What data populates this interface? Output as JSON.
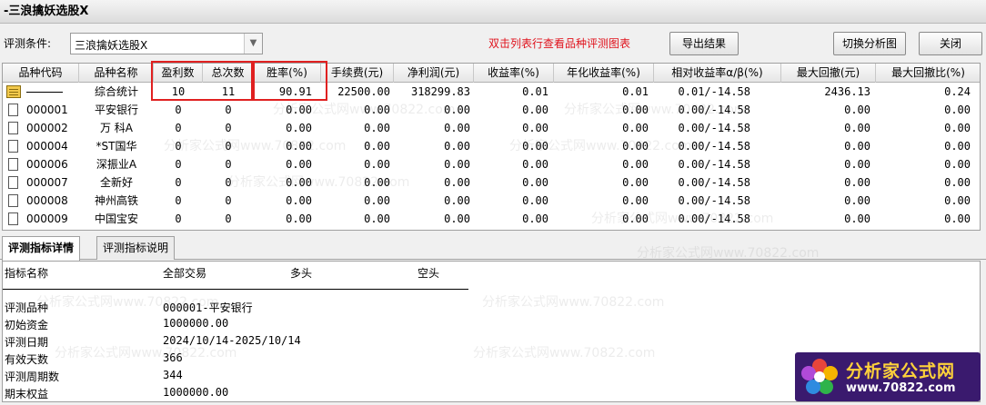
{
  "window": {
    "title": "-三浪擒妖选股X"
  },
  "toolbar": {
    "condition_label": "评测条件:",
    "condition_value": "三浪擒妖选股X",
    "hint": "双击列表行查看品种评测图表",
    "export_label": "导出结果",
    "switch_label": "切换分析图",
    "close_label": "关闭"
  },
  "table": {
    "headers": [
      "品种代码",
      "品种名称",
      "盈利数",
      "总次数",
      "胜率(%)",
      "手续费(元)",
      "净利润(元)",
      "收益率(%)",
      "年化收益率(%)",
      "相对收益率α/β(%)",
      "最大回撤(元)",
      "最大回撤比(%)"
    ],
    "rows": [
      {
        "code": "",
        "name": "综合统计",
        "wins": "10",
        "total": "11",
        "winrate": "90.91",
        "fee": "22500.00",
        "profit": "318299.83",
        "ret": "0.01",
        "annual": "0.01",
        "relative": "0.01/-14.58",
        "maxdd": "2436.13",
        "maxddr": "0.24"
      },
      {
        "code": "000001",
        "name": "平安银行",
        "wins": "0",
        "total": "0",
        "winrate": "0.00",
        "fee": "0.00",
        "profit": "0.00",
        "ret": "0.00",
        "annual": "0.00",
        "relative": "0.00/-14.58",
        "maxdd": "0.00",
        "maxddr": "0.00"
      },
      {
        "code": "000002",
        "name": "万 科A",
        "wins": "0",
        "total": "0",
        "winrate": "0.00",
        "fee": "0.00",
        "profit": "0.00",
        "ret": "0.00",
        "annual": "0.00",
        "relative": "0.00/-14.58",
        "maxdd": "0.00",
        "maxddr": "0.00"
      },
      {
        "code": "000004",
        "name": "*ST国华",
        "wins": "0",
        "total": "0",
        "winrate": "0.00",
        "fee": "0.00",
        "profit": "0.00",
        "ret": "0.00",
        "annual": "0.00",
        "relative": "0.00/-14.58",
        "maxdd": "0.00",
        "maxddr": "0.00"
      },
      {
        "code": "000006",
        "name": "深振业A",
        "wins": "0",
        "total": "0",
        "winrate": "0.00",
        "fee": "0.00",
        "profit": "0.00",
        "ret": "0.00",
        "annual": "0.00",
        "relative": "0.00/-14.58",
        "maxdd": "0.00",
        "maxddr": "0.00"
      },
      {
        "code": "000007",
        "name": "全新好",
        "wins": "0",
        "total": "0",
        "winrate": "0.00",
        "fee": "0.00",
        "profit": "0.00",
        "ret": "0.00",
        "annual": "0.00",
        "relative": "0.00/-14.58",
        "maxdd": "0.00",
        "maxddr": "0.00"
      },
      {
        "code": "000008",
        "name": "神州高铁",
        "wins": "0",
        "total": "0",
        "winrate": "0.00",
        "fee": "0.00",
        "profit": "0.00",
        "ret": "0.00",
        "annual": "0.00",
        "relative": "0.00/-14.58",
        "maxdd": "0.00",
        "maxddr": "0.00"
      },
      {
        "code": "000009",
        "name": "中国宝安",
        "wins": "0",
        "total": "0",
        "winrate": "0.00",
        "fee": "0.00",
        "profit": "0.00",
        "ret": "0.00",
        "annual": "0.00",
        "relative": "0.00/-14.58",
        "maxdd": "0.00",
        "maxddr": "0.00"
      }
    ]
  },
  "tabs": [
    {
      "label": "评测指标详情",
      "active": true
    },
    {
      "label": "评测指标说明",
      "active": false
    }
  ],
  "detail": {
    "headers": [
      "指标名称",
      "全部交易",
      "多头",
      "空头"
    ],
    "rows": [
      {
        "label": "评测品种",
        "value": "000001-平安银行"
      },
      {
        "label": "初始资金",
        "value": "1000000.00"
      },
      {
        "label": "评测日期",
        "value": "2024/10/14-2025/10/14"
      },
      {
        "label": "有效天数",
        "value": "366"
      },
      {
        "label": "评测周期数",
        "value": "344"
      },
      {
        "label": "期末权益",
        "value": "1000000.00"
      }
    ]
  },
  "watermark": "分析家公式网www.70822.com",
  "logo": {
    "title": "分析家公式网",
    "url": "www.70822.com"
  },
  "colors": {
    "highlight_box": "#e02020",
    "hint_text": "#e0121c",
    "logo_bg": "#3a1a6e",
    "logo_title": "#ffd23a"
  }
}
